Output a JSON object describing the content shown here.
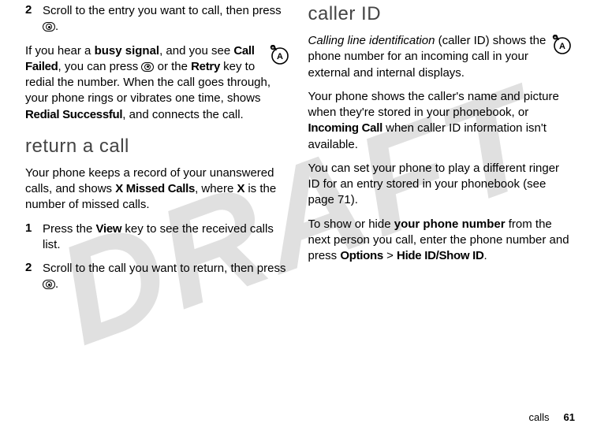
{
  "watermark": "DRAFT",
  "left": {
    "step2_num": "2",
    "step2_text_a": "Scroll to the entry you want to call, then press ",
    "step2_text_b": ".",
    "busy_p_a": "If you hear a ",
    "busy_bold": "busy signal",
    "busy_p_b": ", and you see ",
    "call_failed": "Call Failed",
    "busy_p_c": ", you can press ",
    "busy_p_d": " or the ",
    "retry": "Retry",
    "busy_p_e": " key to redial the number. When the call goes through, your phone rings or vibrates one time, shows ",
    "redial_successful": "Redial Successful",
    "busy_p_f": ", and connects the call.",
    "return_heading": "return a call",
    "return_p_a": "Your phone keeps a record of your unanswered calls, and shows ",
    "x_missed": "X Missed Calls",
    "return_p_b": ", where ",
    "x_bold": "X",
    "return_p_c": " is the number of missed calls.",
    "ret_step1_num": "1",
    "ret_step1_a": "Press the ",
    "view": "View",
    "ret_step1_b": " key to see the received calls list.",
    "ret_step2_num": "2",
    "ret_step2_a": "Scroll to the call you want to return, then press ",
    "ret_step2_b": "."
  },
  "right": {
    "caller_heading": "caller ID",
    "cli_italic": "Calling line identification",
    "cli_a": " (caller ID) shows the phone number for an incoming call in your external and internal displays.",
    "p2_a": "Your phone shows the caller's name and picture when they're stored in your phonebook, or ",
    "incoming_call": "Incoming Call",
    "p2_b": " when caller ID information isn't available.",
    "p3": "You can set your phone to play a different ringer ID for an entry stored in your phonebook (see page 71).",
    "p4_a": "To show or hide ",
    "p4_bold": "your phone number",
    "p4_b": " from the next person you call, enter the phone number and press ",
    "options": "Options",
    "gt": " > ",
    "hide_show": "Hide ID/Show ID",
    "p4_c": "."
  },
  "footer": {
    "label": "calls",
    "page": "61"
  }
}
